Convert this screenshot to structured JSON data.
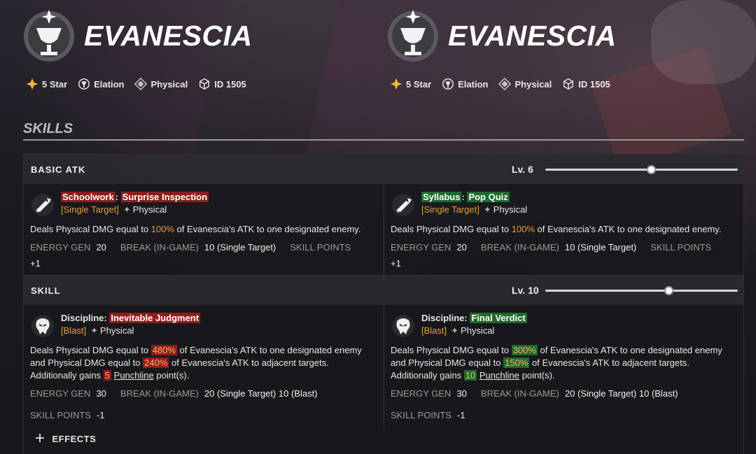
{
  "characters": [
    {
      "name": "EVANESCIA",
      "meta": {
        "rarity": "5 Star",
        "path": "Elation",
        "element": "Physical",
        "id": "ID 1505"
      }
    },
    {
      "name": "EVANESCIA",
      "meta": {
        "rarity": "5 Star",
        "path": "Elation",
        "element": "Physical",
        "id": "ID 1505"
      }
    }
  ],
  "skills_heading": "SKILLS",
  "colors": {
    "accent_red": "#8f1c1c",
    "accent_green": "#1f6a2c",
    "number_orange": "#ef9a38",
    "target_gold": "#e0a23a"
  },
  "basic_atk": {
    "title": "BASIC ATK",
    "level": "Lv. 6",
    "slider_fraction": 0.55,
    "left": {
      "icon": "basic-atk-icon",
      "name_prefix": "Schoolwork",
      "sep": ":",
      "name_suffix": "Surprise Inspection",
      "target": "[Single Target]",
      "element": "Physical",
      "desc": {
        "a": "Deals Physical DMG equal to ",
        "n1": "100%",
        "b": " of Evanescia's ATK to one designated enemy."
      },
      "stats": {
        "energy_k": "ENERGY GEN",
        "energy_v": "20",
        "break_k": "BREAK (IN-GAME)",
        "break_v": "10 (Single Target)",
        "sp_k": "SKILL POINTS",
        "sp_v": "+1"
      }
    },
    "right": {
      "icon": "basic-atk-icon",
      "name_prefix": "Syllabus",
      "sep": ":",
      "name_suffix": "Pop Quiz",
      "target": "[Single Target]",
      "element": "Physical",
      "desc": {
        "a": "Deals Physical DMG equal to ",
        "n1": "100%",
        "b": " of Evanescia's ATK to one designated enemy."
      },
      "stats": {
        "energy_k": "ENERGY GEN",
        "energy_v": "20",
        "break_k": "BREAK (IN-GAME)",
        "break_v": "10 (Single Target)",
        "sp_k": "SKILL POINTS",
        "sp_v": "+1"
      }
    }
  },
  "skill": {
    "title": "SKILL",
    "level": "Lv. 10",
    "slider_fraction": 0.64,
    "left": {
      "icon": "skill-icon",
      "name_prefix": "Discipline:",
      "name_suffix": "Inevitable Judgment",
      "target": "[Blast]",
      "element": "Physical",
      "desc": {
        "a": "Deals Physical DMG equal to ",
        "n1": "480%",
        "b": " of Evanescia's ATK to one designated enemy",
        "c": "and Physical DMG equal to ",
        "n2": "240%",
        "d": " of Evanescia's ATK to adjacent targets.",
        "e": "Additionally gains ",
        "n3": "5",
        "f": "Punchline",
        "g": " point(s)."
      },
      "stats": {
        "energy_k": "ENERGY GEN",
        "energy_v": "30",
        "break_k": "BREAK (IN-GAME)",
        "break_v": "20 (Single Target) 10 (Blast)",
        "sp_k": "SKILL POINTS",
        "sp_v": "-1"
      }
    },
    "right": {
      "icon": "skill-icon",
      "name_prefix": "Discipline:",
      "name_suffix": "Final Verdict",
      "target": "[Blast]",
      "element": "Physical",
      "desc": {
        "a": "Deals Physical DMG equal to ",
        "n1": "300%",
        "b": " of Evanescia's ATK to one designated enemy",
        "c": "and Physical DMG equal to ",
        "n2": "150%",
        "d": " of Evanescia's ATK to adjacent targets.",
        "e": "Additionally gains ",
        "n3": "10",
        "f": "Punchline",
        "g": " point(s)."
      },
      "stats": {
        "energy_k": "ENERGY GEN",
        "energy_v": "30",
        "break_k": "BREAK (IN-GAME)",
        "break_v": "20 (Single Target) 10 (Blast)",
        "sp_k": "SKILL POINTS",
        "sp_v": "-1"
      }
    },
    "effects_label": "EFFECTS"
  }
}
